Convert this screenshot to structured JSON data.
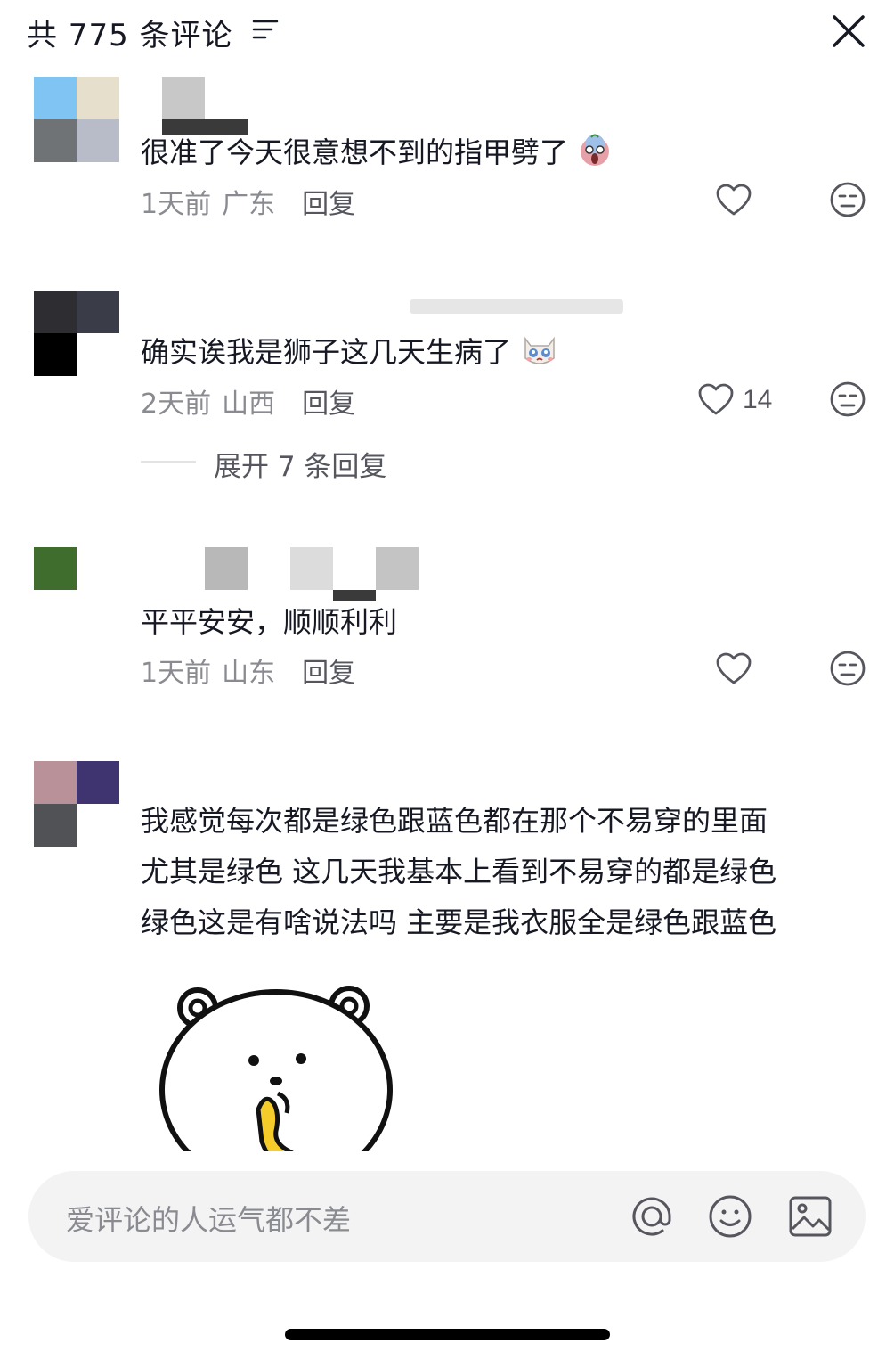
{
  "header": {
    "title": "共 775 条评论",
    "filter_icon": "filter-lines-icon",
    "close_icon": "close-x-icon"
  },
  "comments": [
    {
      "text": "很准了今天很意想不到的指甲劈了",
      "emoji": "scream-emoji",
      "time": "1天前",
      "location": "广东",
      "reply_label": "回复",
      "likes": "",
      "avatar_colors": [
        "#7fc4f2",
        "#e6dfcc",
        "#6f7375",
        "#b8bcc8"
      ]
    },
    {
      "text": "确实诶我是狮子这几天生病了",
      "emoji": "crying-cat-emoji",
      "time": "2天前",
      "location": "山西",
      "reply_label": "回复",
      "likes": "14",
      "expand_label": "展开 7 条回复",
      "avatar_colors": [
        "#2e2e32",
        "#3a3d48",
        "#000000",
        "#ffffff"
      ]
    },
    {
      "text": "平平安安，顺顺利利",
      "time": "1天前",
      "location": "山东",
      "reply_label": "回复",
      "likes": "",
      "avatar_colors": [
        "#3e6d2e",
        "#ffffff",
        "#ffffff",
        "#ffffff"
      ]
    },
    {
      "lines": [
        "我感觉每次都是绿色跟蓝色都在那个不易穿的里面",
        "尤其是绿色 这几天我基本上看到不易穿的都是绿色",
        "绿色这是有啥说法吗 主要是我衣服全是绿色跟蓝色"
      ],
      "sticker": "white-bear-sticker",
      "avatar_colors": [
        "#b89298",
        "#3f3470",
        "#505256",
        "#ffffff"
      ]
    }
  ],
  "input": {
    "placeholder": "爱评论的人运气都不差",
    "icons": [
      "at-icon",
      "emoji-icon",
      "image-icon"
    ]
  },
  "colors": {
    "text_primary": "#161823",
    "text_secondary": "#8a8b91",
    "input_bg": "#f3f3f4"
  }
}
